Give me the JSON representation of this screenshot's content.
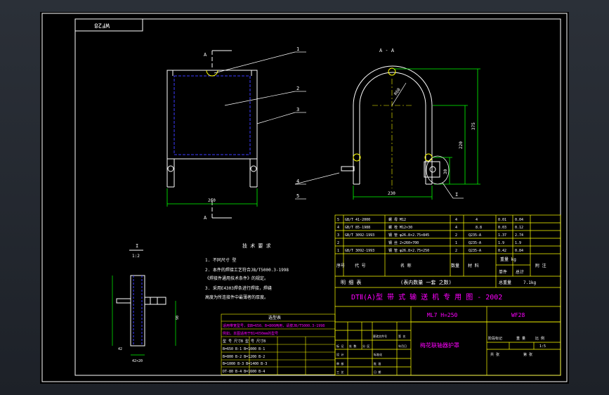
{
  "colors": {
    "background": "#000000",
    "frame": "#ffffff",
    "title_block": "#ffff00",
    "outline": "#ffffff",
    "hidden_line": "#3b3bff",
    "dimension": "#00ff00",
    "annotation": "#ffffff",
    "title_text": "#ff00ff",
    "leader": "#00ffff"
  },
  "drawing": {
    "stamp": "WF28",
    "section_mark": "A",
    "section_title": "A - A",
    "detail_title": "I",
    "detail_scale": "1:2",
    "part_numbers": [
      "1",
      "2",
      "3",
      "4",
      "5"
    ],
    "dimensions": {
      "overall_height": "375",
      "inner_height": "220",
      "radius": "R60",
      "base_width": "230",
      "front_width": "260",
      "offset": "30",
      "detail_length": "90",
      "detail_bolt": "42",
      "detail_total": "42×20"
    }
  },
  "tech_requirements": {
    "title": "技 术 要 求",
    "items": [
      "1. 不同尺寸 型",
      "2. 本件的焊接工艺符合JB/T5000.3-1998",
      "   《焊接件通用技术条件》的规定。",
      "3. 采用E4303焊条进行焊接，焊缝",
      "   高度为所连接件中最薄者的厚度。"
    ]
  },
  "selection_table": {
    "title": "选型表",
    "rows": [
      "适用带宽型号，如B=650、B=800两用，请按JB/T5000.3-1998",
      "例如，本图适用于B1=650mm的型号",
      "型  号    尺寸B    型  号    尺寸B",
      "B=650     B-1     B=1000     B-1",
      "B=800     B-2     B=1200     B-2",
      "B=1000    B-3     B=1400     B-3",
      "DT-80     B-4     B=1600     B-4"
    ]
  },
  "title_block": {
    "header_cols": [
      "序号",
      "代  号",
      "名    称",
      "数量",
      "材    料",
      "单件",
      "总计",
      "附  注"
    ],
    "weight_header": "重量 kg",
    "parts": [
      {
        "no": "5",
        "code": "GB/T 41-2000",
        "name": "螺    母 M12",
        "qty": "4",
        "material": "4",
        "unit": "0.01",
        "total": "0.04"
      },
      {
        "no": "4",
        "code": "GB/T 85-1988",
        "name": "螺    栓 M12×30",
        "qty": "4",
        "material": "8.8",
        "unit": "0.03",
        "total": "0.12"
      },
      {
        "no": "3",
        "code": "GB/T 3092-1993",
        "name": "钢    管 φ26.8×2.75×845",
        "qty": "2",
        "material": "Q235-A",
        "unit": "1.37",
        "total": "2.74"
      },
      {
        "no": "2",
        "code": "",
        "name": "钢    丝 2×260×700",
        "qty": "1",
        "material": "Q235-A",
        "unit": "1.9",
        "total": "1.9"
      },
      {
        "no": "1",
        "code": "GB/T 3092-1993",
        "name": "钢    管 φ26.8×2.75×250",
        "qty": "2",
        "material": "Q235-A",
        "unit": "0.42",
        "total": "0.84"
      }
    ],
    "stock_label": "明  细  表",
    "stock_note": "(表内数量 一套 之数)",
    "total_weight_label": "总重量",
    "total_weight": "7.1kg",
    "main_title": "DTⅡ(A)型  带 式 输 送 机 专 用 图 - 2002",
    "model": "ML7  H=250",
    "drawing_no": "WF28",
    "part_name": "梅花联轴器护罩",
    "stage_label": "阶段标记",
    "weight_label": "重  量",
    "scale_label": "比  例",
    "scale": "1:5",
    "sheet_label": "共  张",
    "sheet_label2": "第  张",
    "sign_labels": [
      "标 记",
      "处 数",
      "分 区",
      "更改文件号",
      "签 名",
      "年月日"
    ],
    "role_labels": [
      "设 计",
      "审 核",
      "工 艺",
      "标准化",
      "批 准"
    ],
    "date_label": "日 期"
  }
}
